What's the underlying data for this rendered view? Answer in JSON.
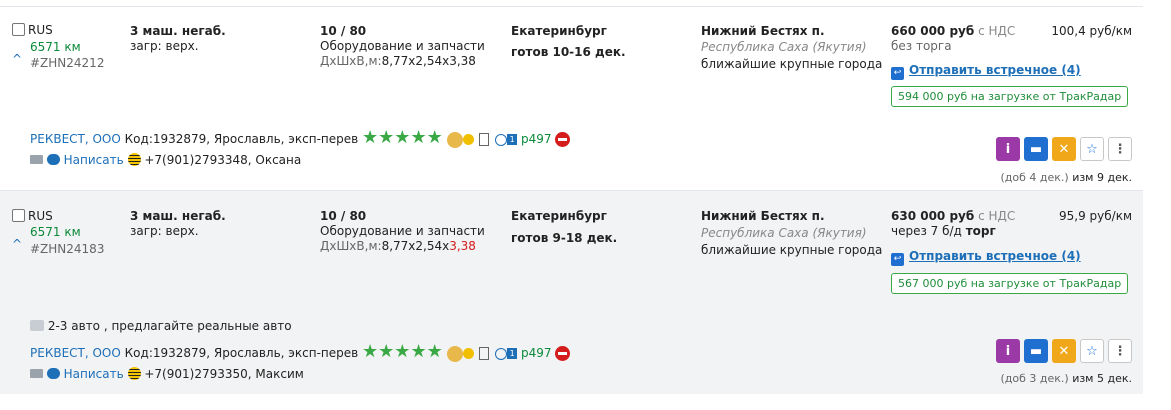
{
  "rows": [
    {
      "country": "RUS",
      "distance": "6571 км",
      "code": "#ZHN24212",
      "trucks": "3 маш. негаб.",
      "loading": "загр: верх.",
      "weight_volume": "10 / 80",
      "cargo": "Оборудование и запчасти",
      "dims_label": "ДхШхВ,м:",
      "dims_value": "8,77х2,54х3,38",
      "from_city": "Екатеринбург",
      "ready": "готов 10-16 дек.",
      "to_city": "Нижний Бестях п.",
      "to_region": "Республика Саха (Якутия)",
      "to_note": "ближайшие крупные города",
      "price": "660 000 руб",
      "vat": "с НДС",
      "terms": "без торга",
      "rate": "100,4 руб/км",
      "counter_offer": "Отправить встречное (4)",
      "trakradar": "594 000 руб на загрузке от ТракРадар",
      "company": "РЕКВЕСТ, ООО",
      "company_info": "Код:1932879, Ярославль, эксп-перев",
      "rating_code": "р497",
      "write": "Написать",
      "phone": "+7(901)2793348, Оксана",
      "added": "(доб 4 дек.)",
      "changed": "изм 9 дек."
    },
    {
      "country": "RUS",
      "distance": "6571 км",
      "code": "#ZHN24183",
      "trucks": "3 маш. негаб.",
      "loading": "загр: верх.",
      "weight_volume": "10 / 80",
      "cargo": "Оборудование и запчасти",
      "dims_label": "ДхШхВ,м:",
      "dims_value_main": "8,77х2,54х",
      "dims_value_red": "3,38",
      "from_city": "Екатеринбург",
      "ready": "готов 9-18 дек.",
      "to_city": "Нижний Бестях п.",
      "to_region": "Республика Саха (Якутия)",
      "to_note": "ближайшие крупные города",
      "price": "630 000 руб",
      "vat": "с НДС",
      "terms_prefix": "через 7 б/д",
      "terms_bold": "торг",
      "rate": "95,9 руб/км",
      "counter_offer": "Отправить встречное (4)",
      "trakradar": "567 000 руб на загрузке от ТракРадар",
      "note": "2-3 авто , предлагайте реальные авто",
      "company": "РЕКВЕСТ, ООО",
      "company_info": "Код:1932879, Ярославль, эксп-перев",
      "rating_code": "р497",
      "write": "Написать",
      "phone": "+7(901)2793350, Максим",
      "added": "(доб 3 дек.)",
      "changed": "изм 5 дек."
    }
  ],
  "stars": "★★★★★",
  "colors": {
    "link": "#1d6fb8",
    "green": "#3aa845",
    "purple": "#9b3aa6",
    "blue": "#1f6fd1",
    "orange": "#f0a81a"
  }
}
